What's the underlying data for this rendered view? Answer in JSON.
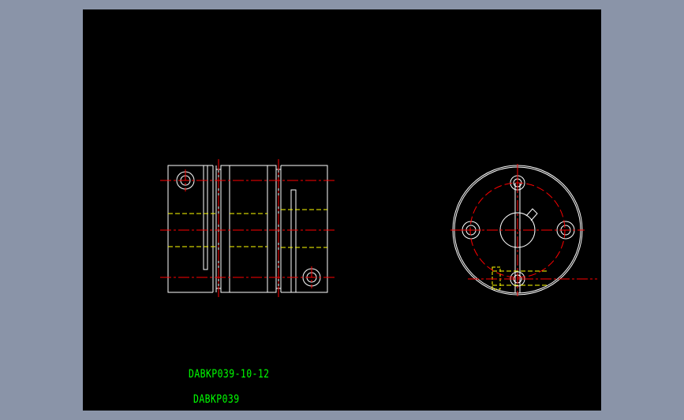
{
  "colors": {
    "background": "#000000",
    "frame": "#8a94a8",
    "outline": "#ffffff",
    "centerline": "#ff0000",
    "hidden": "#ffff00",
    "label": "#00ff00"
  },
  "labels": {
    "part_number": "DABKP039-10-12",
    "model": "DABKP039"
  }
}
